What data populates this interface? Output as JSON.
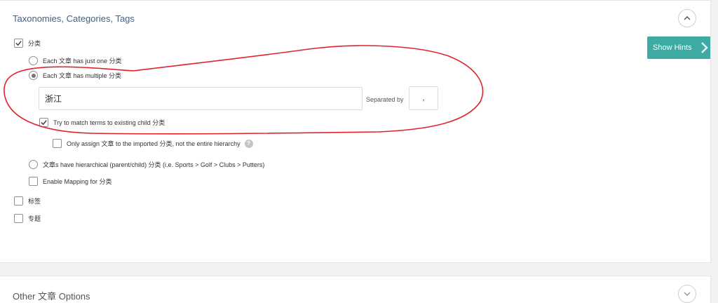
{
  "section1": {
    "title": "Taxonomies, Categories, Tags",
    "category": {
      "label": "分类",
      "checked": true,
      "options": {
        "single": "Each 文章 has just one 分类",
        "multiple": "Each 文章 has multiple 分类",
        "hierarchical": "文章s have hierarchical (parent/child) 分类 (i.e. Sports > Golf > Clubs > Putters)"
      },
      "selected_option": "multiple",
      "terms_value": "浙江",
      "separated_by_label": "Separated by",
      "separator_value": ",",
      "match_terms_label": "Try to match terms to existing child 分类",
      "match_terms_checked": true,
      "only_assign_label": "Only assign 文章 to the imported 分类, not the entire hierarchy",
      "only_assign_checked": false,
      "enable_mapping_label": "Enable Mapping for 分类",
      "enable_mapping_checked": false
    },
    "tags": {
      "label": "标签",
      "checked": false
    },
    "topics": {
      "label": "专题",
      "checked": false
    },
    "toggle_icon": "chevron-up-icon"
  },
  "hints_button": {
    "label": "Show Hints",
    "icon": "chevron-right-icon"
  },
  "section2": {
    "title": "Other 文章 Options",
    "toggle_icon": "chevron-down-icon"
  },
  "colors": {
    "accent": "#3fa9a4",
    "title": "#46607a",
    "annotation": "#e0242a"
  }
}
